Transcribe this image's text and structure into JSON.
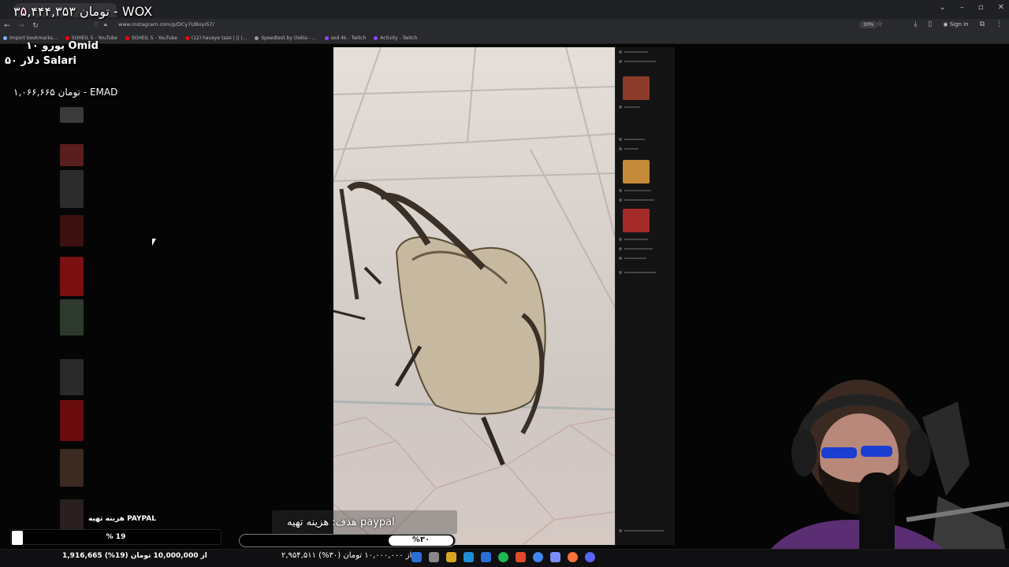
{
  "browser": {
    "tab_title": "",
    "url": "www.instagram.com/p/DCy7UBoyiS7/",
    "zoom": "30%",
    "sign_in_label": "Sign in",
    "bookmarks": [
      {
        "label": "Import bookmarks...",
        "color": "#8ab4f8"
      },
      {
        "label": "SOHEIL S - YouTube",
        "color": "#ff0000"
      },
      {
        "label": "SOHEIL S - YouTube",
        "color": "#ff0000"
      },
      {
        "label": "(12) havaye taze | || |...",
        "color": "#ff0000"
      },
      {
        "label": "Speedtest by Ookla - ...",
        "color": "#999999"
      },
      {
        "label": "sed 4k - Twitch",
        "color": "#9146ff"
      },
      {
        "label": "Activity - Twitch",
        "color": "#9146ff"
      }
    ]
  },
  "overlay": {
    "top_donation": "۳۵,۴۴۴,۳۵۳ تومان - WOX",
    "donations": [
      {
        "text": "۱۰ یورو Omid"
      },
      {
        "text": "۵۰ دلار Salari"
      },
      {
        "text": "۱,۰۶۶,۶۶۵ تومان - EMAD"
      }
    ]
  },
  "goals": {
    "left": {
      "label": "هزینه تهیه PAYPAL",
      "percent_text": "% 19",
      "progress": 0.19,
      "summary": "1,916,665 از 10,000,000 تومان (19%)"
    },
    "mid": {
      "label": "هدف: هزینه تهیه paypal",
      "percent_text": "%۳۰",
      "progress": 0.3,
      "summary": "۲,۹۵۴,۵۱۱ از ۱۰,۰۰۰,۰۰۰ تومان (۳۰%)"
    }
  },
  "icons": {
    "taskbar": [
      "windows-icon",
      "search-icon",
      "folder-icon",
      "edge-icon",
      "store-icon",
      "spotify-icon",
      "office-icon",
      "chrome-icon",
      "tool-icon",
      "firefox-icon",
      "discord-icon"
    ]
  }
}
